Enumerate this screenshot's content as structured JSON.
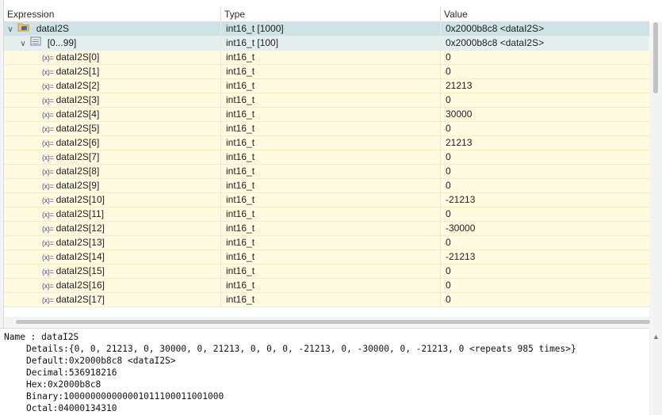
{
  "columns": {
    "expression": "Expression",
    "type": "Type",
    "value": "Value"
  },
  "root": {
    "expression": "dataI2S",
    "type": "int16_t [1000]",
    "value": "0x2000b8c8 <dataI2S>"
  },
  "group": {
    "expression": "[0...99]",
    "type": "int16_t [100]",
    "value": "0x2000b8c8 <dataI2S>"
  },
  "elements": [
    {
      "expression": "dataI2S[0]",
      "type": "int16_t",
      "value": "0"
    },
    {
      "expression": "dataI2S[1]",
      "type": "int16_t",
      "value": "0"
    },
    {
      "expression": "dataI2S[2]",
      "type": "int16_t",
      "value": "21213"
    },
    {
      "expression": "dataI2S[3]",
      "type": "int16_t",
      "value": "0"
    },
    {
      "expression": "dataI2S[4]",
      "type": "int16_t",
      "value": "30000"
    },
    {
      "expression": "dataI2S[5]",
      "type": "int16_t",
      "value": "0"
    },
    {
      "expression": "dataI2S[6]",
      "type": "int16_t",
      "value": "21213"
    },
    {
      "expression": "dataI2S[7]",
      "type": "int16_t",
      "value": "0"
    },
    {
      "expression": "dataI2S[8]",
      "type": "int16_t",
      "value": "0"
    },
    {
      "expression": "dataI2S[9]",
      "type": "int16_t",
      "value": "0"
    },
    {
      "expression": "dataI2S[10]",
      "type": "int16_t",
      "value": "-21213"
    },
    {
      "expression": "dataI2S[11]",
      "type": "int16_t",
      "value": "0"
    },
    {
      "expression": "dataI2S[12]",
      "type": "int16_t",
      "value": "-30000"
    },
    {
      "expression": "dataI2S[13]",
      "type": "int16_t",
      "value": "0"
    },
    {
      "expression": "dataI2S[14]",
      "type": "int16_t",
      "value": "-21213"
    },
    {
      "expression": "dataI2S[15]",
      "type": "int16_t",
      "value": "0"
    },
    {
      "expression": "dataI2S[16]",
      "type": "int16_t",
      "value": "0"
    },
    {
      "expression": "dataI2S[17]",
      "type": "int16_t",
      "value": "0"
    }
  ],
  "variable_icon_text": "(x)=",
  "details": {
    "name": "Name : dataI2S",
    "lines": [
      "Details:{0, 0, 21213, 0, 30000, 0, 21213, 0, 0, 0, -21213, 0, -30000, 0, -21213, 0 <repeats 985 times>}",
      "Default:0x2000b8c8 <dataI2S>",
      "Decimal:536918216",
      "Hex:0x2000b8c8",
      "Binary:100000000000001011100011001000",
      "Octal:04000134310"
    ]
  },
  "colors": {
    "selected_row": "#cde3e6",
    "sub_row": "#e3f0ee",
    "value_row": "#fffbe0"
  }
}
